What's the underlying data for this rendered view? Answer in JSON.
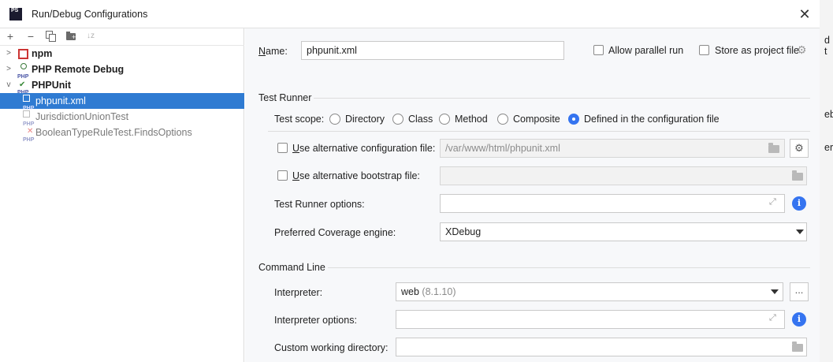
{
  "window": {
    "title": "Run/Debug Configurations",
    "app_icon": "PS",
    "close": "✕"
  },
  "toolbar": {
    "add": "+",
    "remove": "−",
    "copy": "copy-icon",
    "folder": "new-folder-icon",
    "sort": "sort-icon"
  },
  "tree": {
    "npm": "npm",
    "php_remote_debug": "PHP Remote Debug",
    "phpunit": "PHPUnit",
    "phpunit_xml": "phpunit.xml",
    "jurisdiction": "JurisdictionUnionTest",
    "boolean": "BooleanTypeRuleTest.FindsOptions"
  },
  "form": {
    "name_label": "Name:",
    "name_value": "phpunit.xml",
    "allow_parallel": "Allow parallel run",
    "store_project_file": "Store as project file",
    "test_runner_section": "Test Runner",
    "test_scope_label": "Test scope:",
    "scope_options": [
      "Directory",
      "Class",
      "Method",
      "Composite",
      "Defined in the configuration file"
    ],
    "scope_selected": "Defined in the configuration file",
    "alt_config_label": "Use alternative configuration file:",
    "alt_config_value": "/var/www/html/phpunit.xml",
    "alt_bootstrap_label": "Use alternative bootstrap file:",
    "test_runner_options_label": "Test Runner options:",
    "coverage_label": "Preferred Coverage engine:",
    "coverage_value": "XDebug",
    "command_line_section": "Command Line",
    "interpreter_label": "Interpreter:",
    "interpreter_name": "web",
    "interpreter_version": "(8.1.10)",
    "interpreter_more": "...",
    "interpreter_options_label": "Interpreter options:",
    "working_dir_label": "Custom working directory:",
    "info": "i"
  },
  "background_fragments": {
    "a": "d t",
    "b": "eb",
    "c": "er"
  }
}
